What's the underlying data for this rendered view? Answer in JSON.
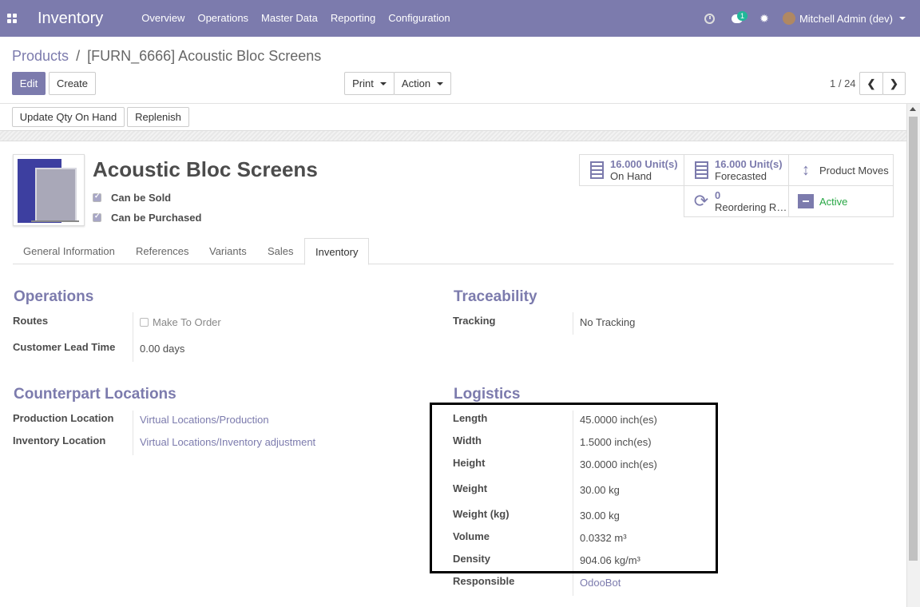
{
  "navbar": {
    "app_name": "Inventory",
    "menu": [
      "Overview",
      "Operations",
      "Master Data",
      "Reporting",
      "Configuration"
    ],
    "messages_badge": "1",
    "user_name": "Mitchell Admin (dev)"
  },
  "control_panel": {
    "breadcrumb_parent": "Products",
    "breadcrumb_separator": "/",
    "breadcrumb_current": "[FURN_6666] Acoustic Bloc Screens",
    "edit_label": "Edit",
    "create_label": "Create",
    "print_label": "Print",
    "action_label": "Action",
    "pager": "1 / 24"
  },
  "statusbar": {
    "update_qty_label": "Update Qty On Hand",
    "replenish_label": "Replenish"
  },
  "product": {
    "name": "Acoustic Bloc Screens",
    "can_be_sold": "Can be Sold",
    "can_be_purchased": "Can be Purchased"
  },
  "smart_buttons": {
    "on_hand_value": "16.000",
    "on_hand_unit": "Unit(s)",
    "on_hand_label": "On Hand",
    "forecast_value": "16.000",
    "forecast_unit": "Unit(s)",
    "forecast_label": "Forecasted",
    "product_moves_label": "Product Moves",
    "reordering_value": "0",
    "reordering_label": "Reordering R…",
    "active_label": "Active"
  },
  "tabs": [
    "General Information",
    "References",
    "Variants",
    "Sales",
    "Inventory"
  ],
  "operations": {
    "title": "Operations",
    "routes_label": "Routes",
    "make_to_order": "Make To Order",
    "lead_time_label": "Customer Lead Time",
    "lead_time_value": "0.00 days"
  },
  "traceability": {
    "title": "Traceability",
    "tracking_label": "Tracking",
    "tracking_value": "No Tracking"
  },
  "counterpart": {
    "title": "Counterpart Locations",
    "production_label": "Production Location",
    "production_value": "Virtual Locations/Production",
    "inventory_label": "Inventory Location",
    "inventory_value": "Virtual Locations/Inventory adjustment"
  },
  "logistics": {
    "title": "Logistics",
    "length_label": "Length",
    "length_value": "45.0000 inch(es)",
    "width_label": "Width",
    "width_value": "1.5000 inch(es)",
    "height_label": "Height",
    "height_value": "30.0000 inch(es)",
    "weight_label": "Weight",
    "weight_value": "30.00 kg",
    "weight_kg_label": "Weight (kg)",
    "weight_kg_value": "30.00 kg",
    "volume_label": "Volume",
    "volume_value": "0.0332 m³",
    "density_label": "Density",
    "density_value": "904.06 kg/m³",
    "responsible_label": "Responsible",
    "responsible_value": "OdooBot"
  }
}
